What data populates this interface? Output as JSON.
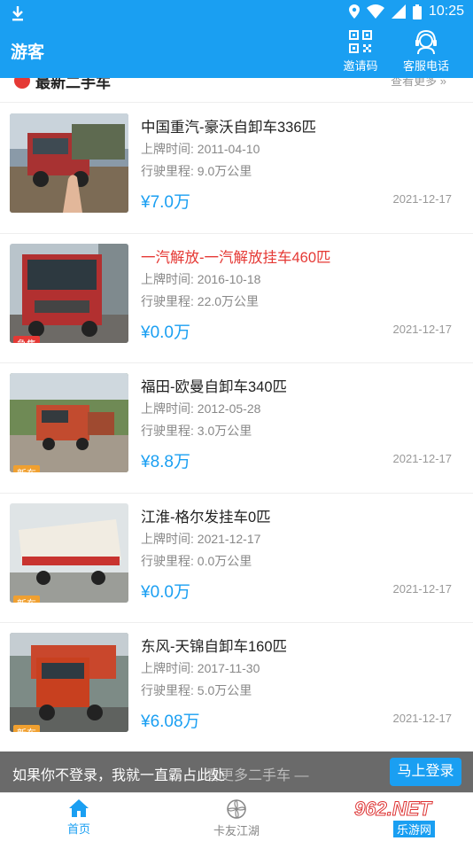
{
  "status_bar": {
    "time": "10:25"
  },
  "app_bar": {
    "title": "游客",
    "invite_label": "邀请码",
    "service_label": "客服电话"
  },
  "section": {
    "title": "最新二手车",
    "more": "查看更多 »"
  },
  "listings": [
    {
      "name": "中国重汽-豪沃自卸车336匹",
      "reg_label": "上牌时间:",
      "reg": "2011-04-10",
      "mileage_label": "行驶里程:",
      "mileage": "9.0万公里",
      "price": "¥7.0万",
      "date": "2021-12-17",
      "badge": "",
      "urgent": false
    },
    {
      "name": "一汽解放-一汽解放挂车460匹",
      "reg_label": "上牌时间:",
      "reg": "2016-10-18",
      "mileage_label": "行驶里程:",
      "mileage": "22.0万公里",
      "price": "¥0.0万",
      "date": "2021-12-17",
      "badge": "急售",
      "urgent": true
    },
    {
      "name": "福田-欧曼自卸车340匹",
      "reg_label": "上牌时间:",
      "reg": "2012-05-28",
      "mileage_label": "行驶里程:",
      "mileage": "3.0万公里",
      "price": "¥8.8万",
      "date": "2021-12-17",
      "badge": "新车",
      "urgent": false
    },
    {
      "name": "江淮-格尔发挂车0匹",
      "reg_label": "上牌时间:",
      "reg": "2021-12-17",
      "mileage_label": "行驶里程:",
      "mileage": "0.0万公里",
      "price": "¥0.0万",
      "date": "2021-12-17",
      "badge": "新车",
      "urgent": false
    },
    {
      "name": "东风-天锦自卸车160匹",
      "reg_label": "上牌时间:",
      "reg": "2017-11-30",
      "mileage_label": "行驶里程:",
      "mileage": "5.0万公里",
      "price": "¥6.08万",
      "date": "2021-12-17",
      "badge": "新车",
      "urgent": false
    }
  ],
  "login_bar": {
    "message": "如果你不登录，我就一直霸占此处",
    "more_text": "看更多二手车 —",
    "button": "马上登录"
  },
  "bottom_nav": {
    "home": "首页",
    "kayou": "卡友江湖"
  },
  "watermark": {
    "main": "962.NET",
    "sub": "乐游网"
  },
  "colors": {
    "primary": "#1a9ff2",
    "urgent": "#e53935",
    "new_badge": "#f0a030"
  }
}
